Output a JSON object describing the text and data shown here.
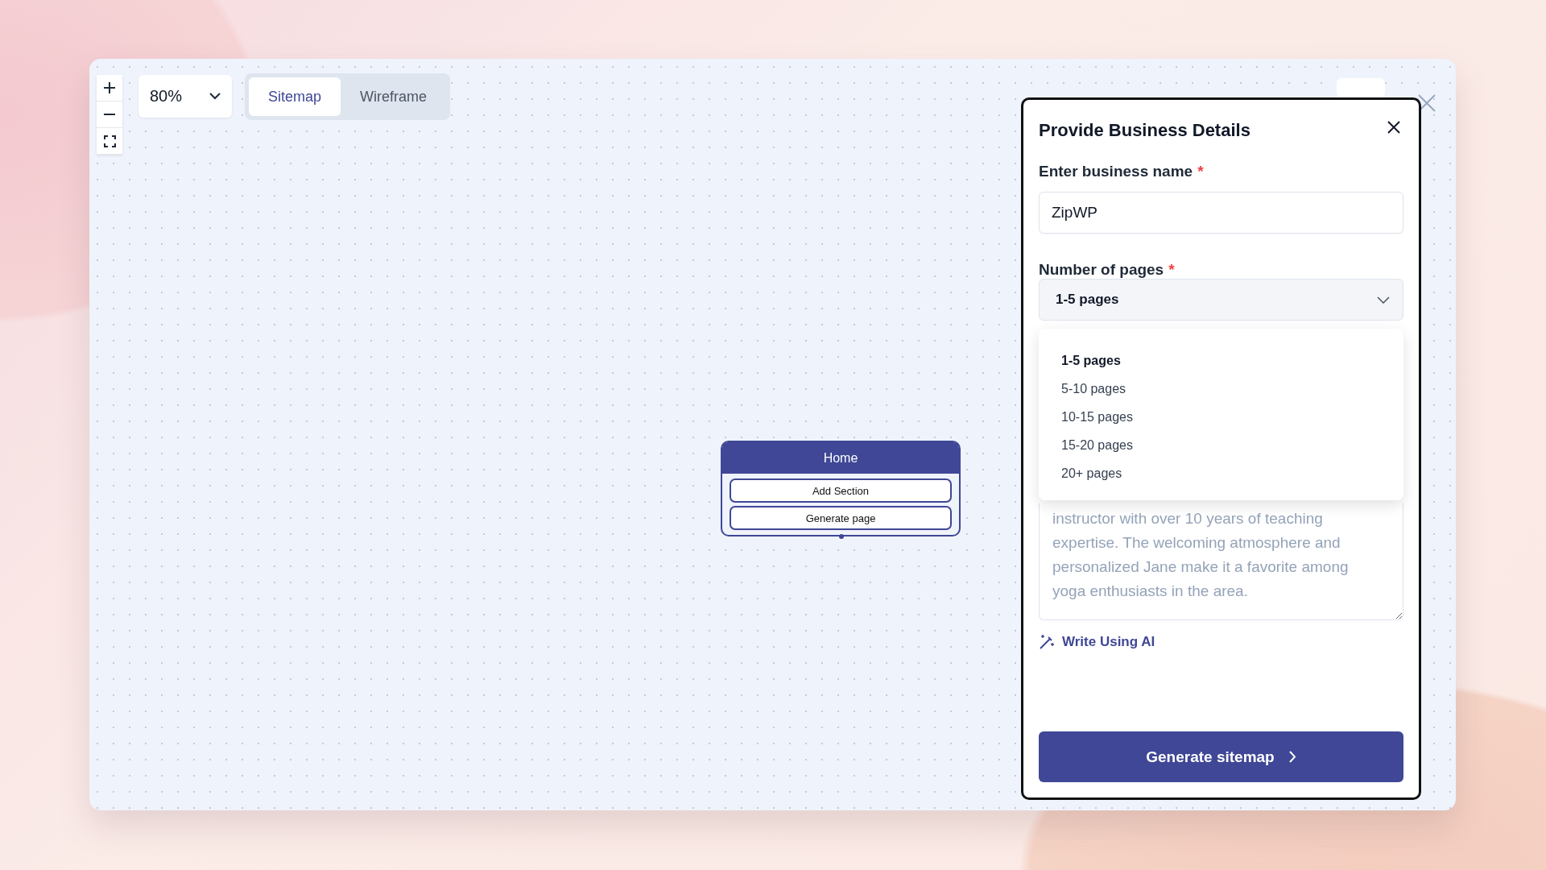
{
  "toolbar": {
    "zoom": {
      "value": "80%"
    },
    "view_tabs": [
      {
        "label": "Sitemap",
        "selected": true
      },
      {
        "label": "Wireframe",
        "selected": false
      }
    ]
  },
  "canvas": {
    "node": {
      "title": "Home",
      "buttons": [
        "Add Section",
        "Generate page"
      ]
    }
  },
  "panel": {
    "title": "Provide Business Details",
    "business_name": {
      "label": "Enter business name",
      "required_mark": "*",
      "value": "ZipWP"
    },
    "pages": {
      "label": "Number of pages",
      "required_mark": "*",
      "value": "1-5 pages",
      "expanded": true,
      "options": [
        {
          "label": "1-5 pages",
          "selected": true
        },
        {
          "label": "5-10 pages",
          "selected": false
        },
        {
          "label": "10-15 pages",
          "selected": false
        },
        {
          "label": "15-20 pages",
          "selected": false
        },
        {
          "label": "20+ pages",
          "selected": false
        }
      ]
    },
    "description": {
      "placeholder": "instructor with over 10 years of teaching expertise. The welcoming atmosphere and personalized Jane make it a favorite among yoga enthusiasts in the area."
    },
    "ai_link": "Write Using AI",
    "submit": "Generate sitemap"
  }
}
